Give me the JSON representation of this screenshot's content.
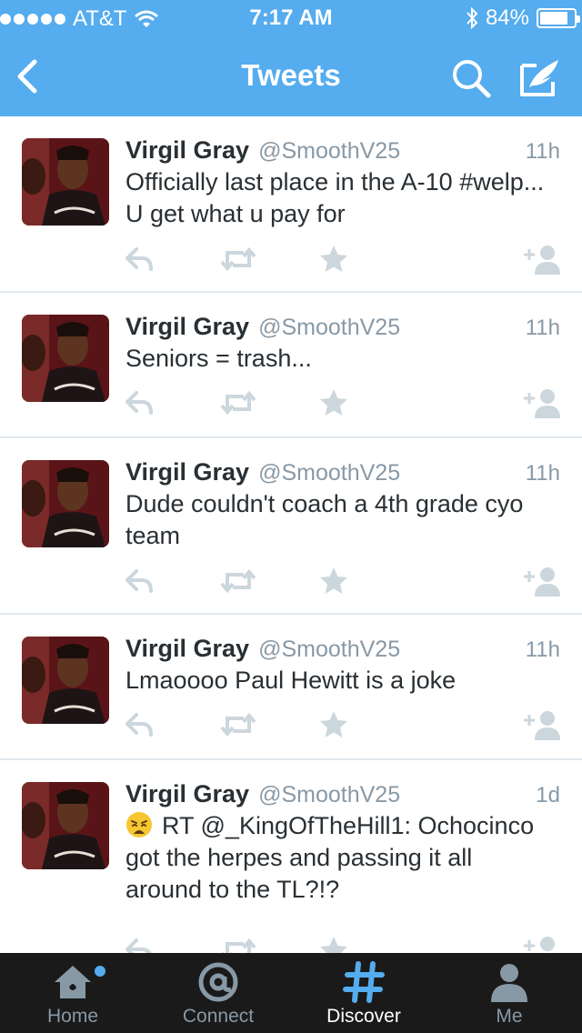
{
  "status_bar": {
    "carrier": "AT&T",
    "time": "7:17 AM",
    "battery": "84%",
    "battery_level": 0.84,
    "signal_bars": 5
  },
  "nav": {
    "title": "Tweets",
    "back_icon": "chevron-left-icon",
    "search_icon": "search-icon",
    "compose_icon": "compose-icon"
  },
  "tweets": [
    {
      "name": "Virgil Gray",
      "handle": "@SmoothV25",
      "time": "11h",
      "text": "Officially last place in the A-10 #welp... U get what u pay for"
    },
    {
      "name": "Virgil Gray",
      "handle": "@SmoothV25",
      "time": "11h",
      "text": "Seniors = trash..."
    },
    {
      "name": "Virgil Gray",
      "handle": "@SmoothV25",
      "time": "11h",
      "text": "Dude couldn't coach a 4th grade cyo team"
    },
    {
      "name": "Virgil Gray",
      "handle": "@SmoothV25",
      "time": "11h",
      "text": "Lmaoooo Paul Hewitt is a joke"
    },
    {
      "name": "Virgil Gray",
      "handle": "@SmoothV25",
      "time": "1d",
      "emoji": "weary-face-emoji",
      "text": "RT @_KingOfTheHill1: Ochocinco got the herpes and passing it all around to the TL?!?"
    }
  ],
  "tabs": [
    {
      "label": "Home",
      "icon": "home-icon",
      "has_notification": true
    },
    {
      "label": "Connect",
      "icon": "at-icon"
    },
    {
      "label": "Discover",
      "icon": "hashtag-icon",
      "active": true
    },
    {
      "label": "Me",
      "icon": "person-icon"
    }
  ],
  "colors": {
    "brand": "#55acee",
    "text": "#292f33",
    "muted": "#8899a6",
    "action_icon": "#ccd6dd",
    "tabbar": "#1a1a1a"
  }
}
